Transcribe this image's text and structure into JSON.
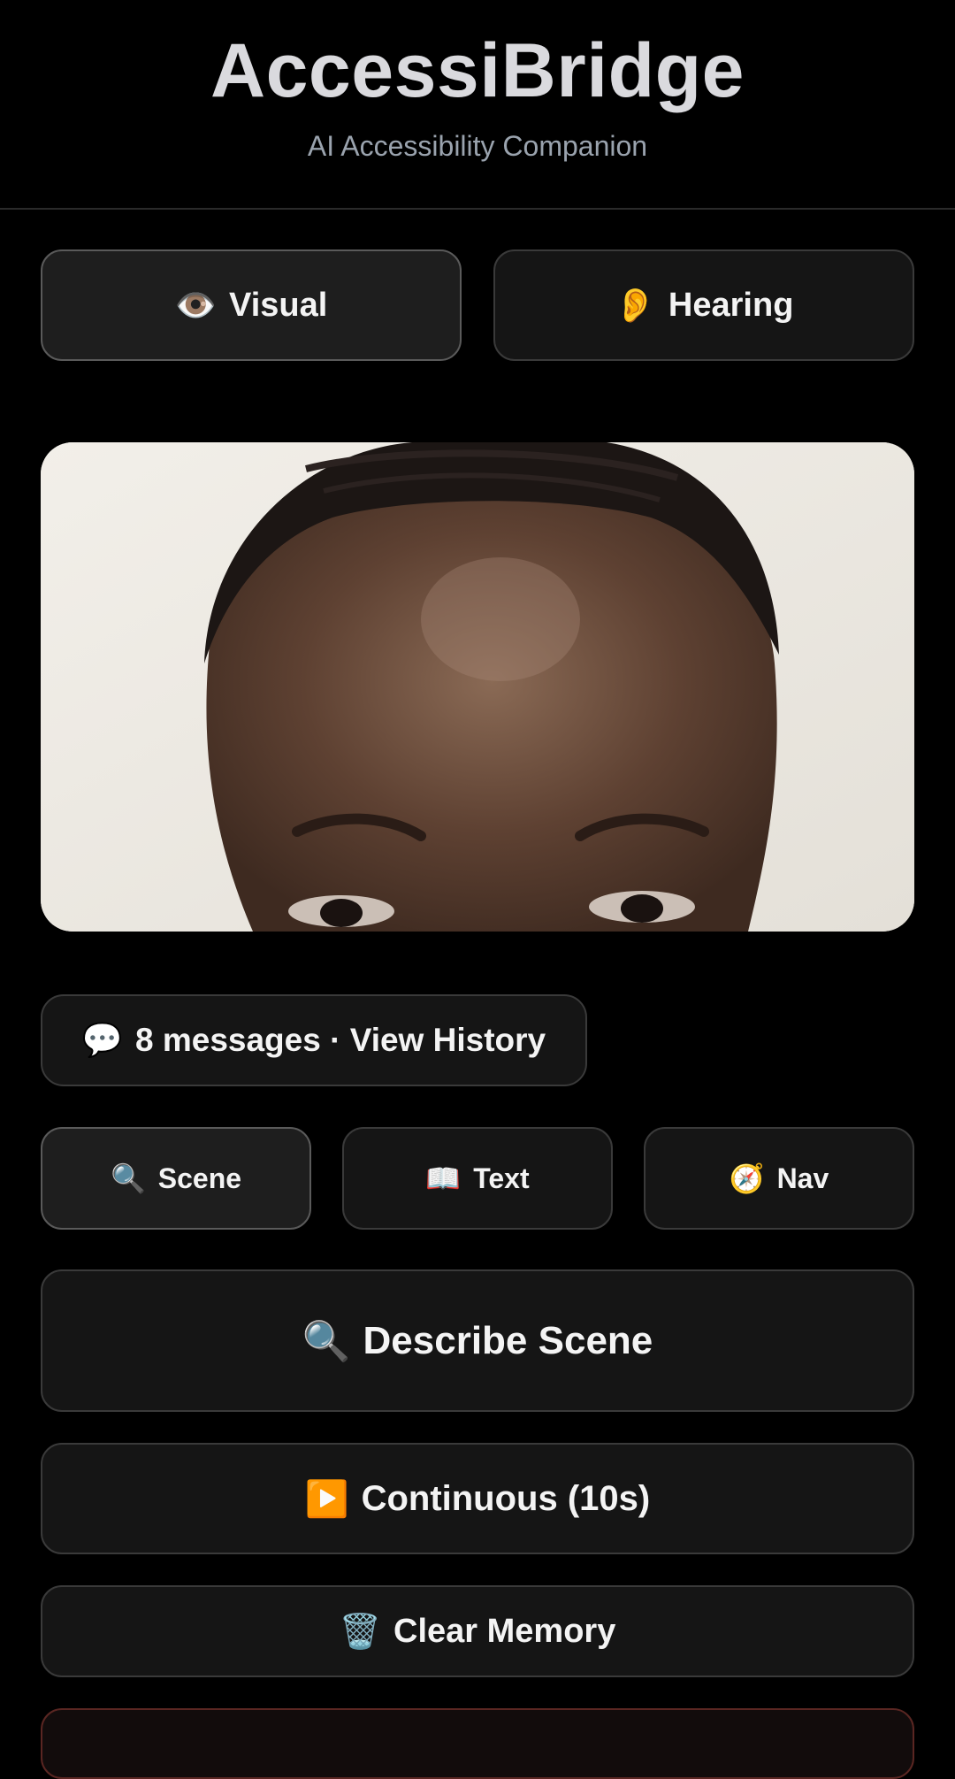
{
  "header": {
    "title": "AccessiBridge",
    "subtitle": "AI Accessibility Companion"
  },
  "modes": {
    "visual": {
      "icon": "👁️",
      "label": "Visual",
      "active": true
    },
    "hearing": {
      "icon": "👂",
      "label": "Hearing",
      "active": false
    }
  },
  "camera": {
    "icon": "camera-preview"
  },
  "history": {
    "icon": "💬",
    "label": "8 messages · View History"
  },
  "tabs": {
    "scene": {
      "icon": "🔍",
      "label": "Scene",
      "active": true
    },
    "text": {
      "icon": "📖",
      "label": "Text"
    },
    "nav": {
      "icon": "🧭",
      "label": "Nav"
    }
  },
  "actions": {
    "describe": {
      "icon": "🔍",
      "label": "Describe Scene"
    },
    "continuous": {
      "icon": "▶️",
      "label": "Continuous (10s)"
    },
    "clear": {
      "icon": "🗑️",
      "label": "Clear Memory"
    }
  },
  "colors": {
    "background": "#000000",
    "button_bg": "#151515",
    "button_border": "#3a3a3a",
    "title": "#dadade",
    "subtitle": "#9aa3ae"
  }
}
